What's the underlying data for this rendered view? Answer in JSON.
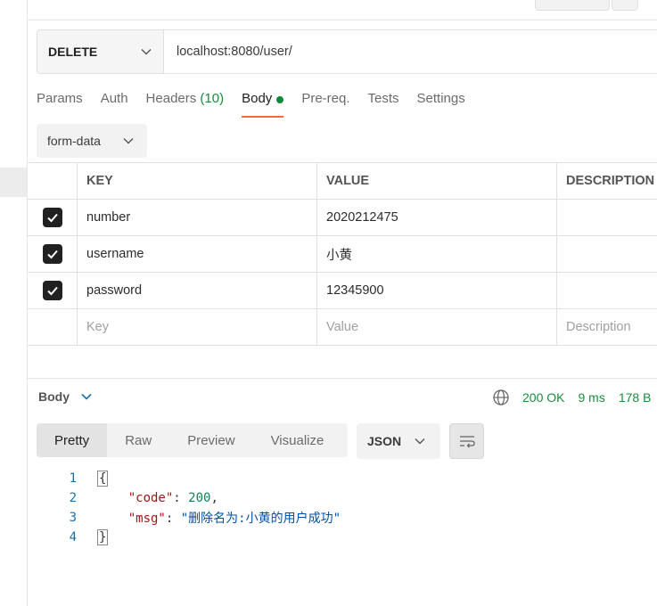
{
  "request": {
    "method": "DELETE",
    "url": "localhost:8080/user/"
  },
  "tabs": [
    {
      "label": "Params"
    },
    {
      "label": "Auth"
    },
    {
      "label": "Headers",
      "count": "(10)"
    },
    {
      "label": "Body",
      "active": true
    },
    {
      "label": "Pre-req."
    },
    {
      "label": "Tests"
    },
    {
      "label": "Settings"
    }
  ],
  "body_mode": "form-data",
  "table": {
    "headers": [
      "KEY",
      "VALUE",
      "DESCRIPTION"
    ],
    "rows": [
      {
        "checked": true,
        "key": "number",
        "value": "2020212475",
        "description": ""
      },
      {
        "checked": true,
        "key": "username",
        "value": "小黄",
        "description": ""
      },
      {
        "checked": true,
        "key": "password",
        "value": "12345900",
        "description": ""
      }
    ],
    "placeholder": {
      "key": "Key",
      "value": "Value",
      "description": "Description"
    }
  },
  "response": {
    "title": "Body",
    "status": "200 OK",
    "time": "9 ms",
    "size": "178 B",
    "view_tabs": [
      "Pretty",
      "Raw",
      "Preview",
      "Visualize"
    ],
    "active_view": "Pretty",
    "format": "JSON",
    "lines": [
      {
        "n": "1",
        "open": "{"
      },
      {
        "n": "2",
        "key": "\"code\"",
        "value": "200",
        "type": "num"
      },
      {
        "n": "3",
        "key": "\"msg\"",
        "value": "\"删除名为:小黄的用户成功\"",
        "type": "str"
      },
      {
        "n": "4",
        "close": "}"
      }
    ]
  },
  "colors": {
    "accent_orange": "#f26b3a",
    "status_green": "#1a8c3c",
    "dot_green": "#0c8a3b"
  }
}
